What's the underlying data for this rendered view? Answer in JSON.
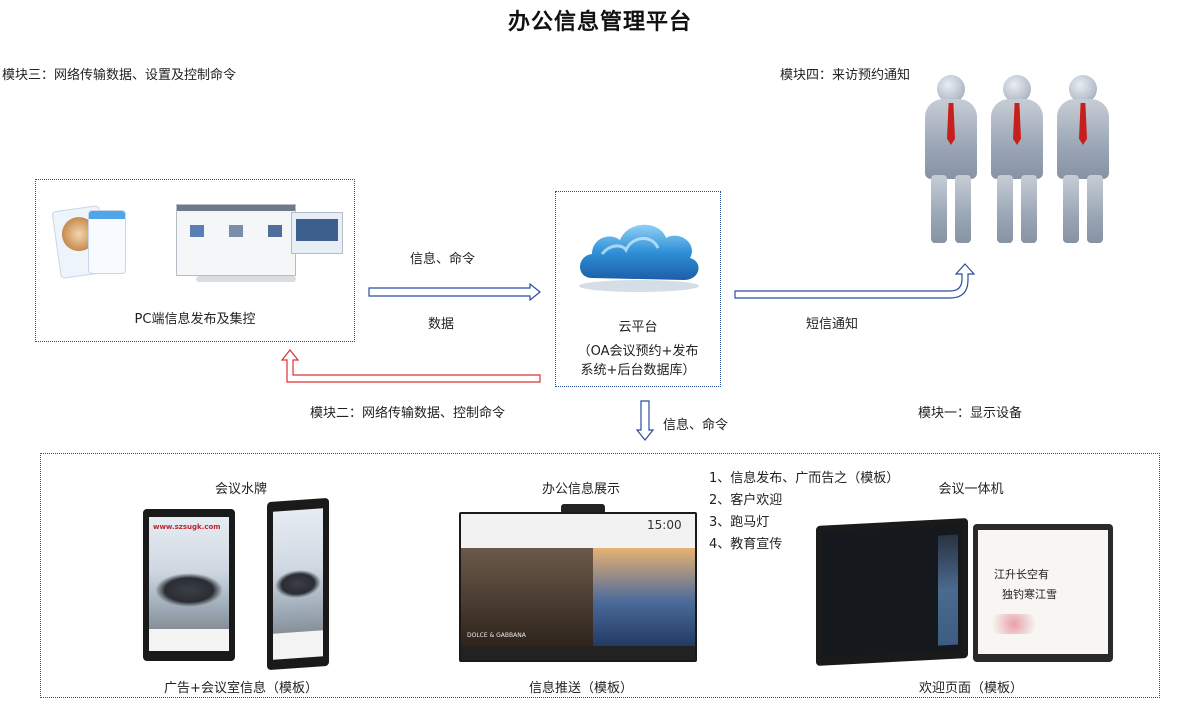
{
  "title": "办公信息管理平台",
  "labels": {
    "module3": "模块三：网络传输数据、设置及控制命令",
    "module4": "模块四：来访预约通知",
    "module2": "模块二：网络传输数据、控制命令",
    "module1": "模块一：显示设备"
  },
  "pc": {
    "caption": "PC端信息发布及集控"
  },
  "cloud": {
    "name": "云平台",
    "desc_line1": "（OA会议预约+发布",
    "desc_line2": "系统+后台数据库）"
  },
  "arrows": {
    "pc_to_cloud_top": "信息、命令",
    "pc_to_cloud_bottom": "数据",
    "cloud_to_people": "短信通知",
    "cloud_down": "信息、命令"
  },
  "bottom": {
    "section1_title": "会议水牌",
    "section1_caption": "广告+会议室信息（模板）",
    "section2_title": "办公信息展示",
    "section2_caption": "信息推送（模板）",
    "section3_title": "会议一体机",
    "section3_caption": "欢迎页面（模板）",
    "list": [
      "1、信息发布、广而告之（模板）",
      "2、客户欢迎",
      "3、跑马灯",
      "4、教育宣传"
    ]
  },
  "device_text": {
    "sign_url": "www.szsugk.com",
    "tv_time": "15:00",
    "tv_brand": "DOLCE & GABBANA",
    "board_text_1": "江升长空有",
    "board_text_2": "独钓寒江雪"
  },
  "colors": {
    "dotted_border": "#2a4f9a",
    "arrow_blue": "#2a4f9a",
    "arrow_red": "#e03030",
    "tie_red": "#c81e1e"
  }
}
